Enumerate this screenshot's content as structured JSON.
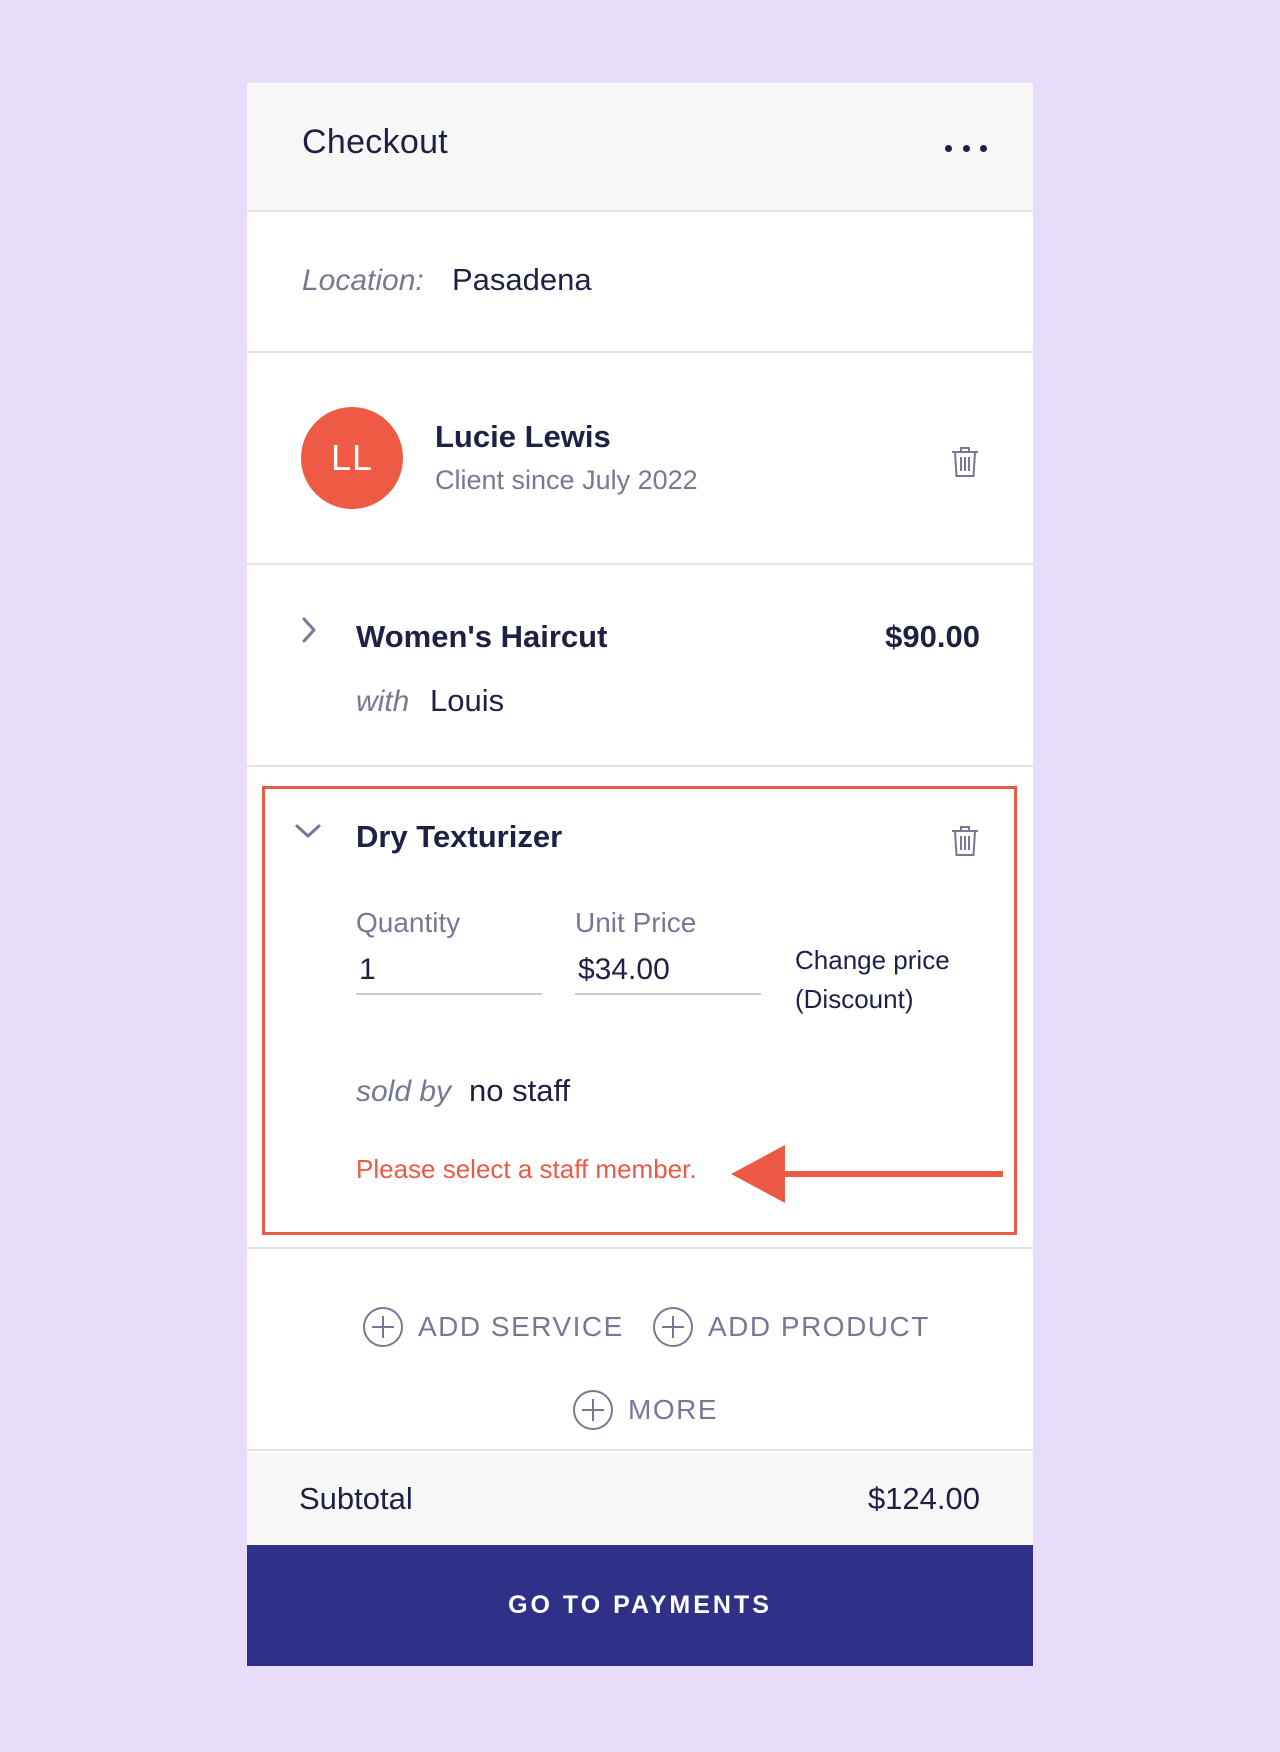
{
  "header": {
    "title": "Checkout",
    "more_icon": "more-horizontal-icon"
  },
  "location": {
    "label": "Location:",
    "value": "Pasadena"
  },
  "client": {
    "initials": "LL",
    "name": "Lucie Lewis",
    "since": "Client since July 2022",
    "avatar_color": "#ef5a45"
  },
  "service": {
    "name": "Women's Haircut",
    "price": "$90.00",
    "with_label": "with",
    "staff": "Louis"
  },
  "product": {
    "name": "Dry Texturizer",
    "quantity_label": "Quantity",
    "quantity_value": "1",
    "unit_price_label": "Unit Price",
    "unit_price_value": "$34.00",
    "change_price_line1": "Change price",
    "change_price_line2": "(Discount)",
    "sold_by_label": "sold by",
    "sold_by_value": "no staff",
    "error": "Please select a staff member."
  },
  "actions": {
    "add_service": "ADD SERVICE",
    "add_product": "ADD PRODUCT",
    "more": "MORE"
  },
  "summary": {
    "subtotal_label": "Subtotal",
    "subtotal_value": "$124.00"
  },
  "footer": {
    "pay_label": "GO TO PAYMENTS"
  },
  "colors": {
    "background": "#e8dcfb",
    "primary": "#2e3187",
    "error": "#ec5a47",
    "text": "#1e2145",
    "muted": "#767896"
  }
}
